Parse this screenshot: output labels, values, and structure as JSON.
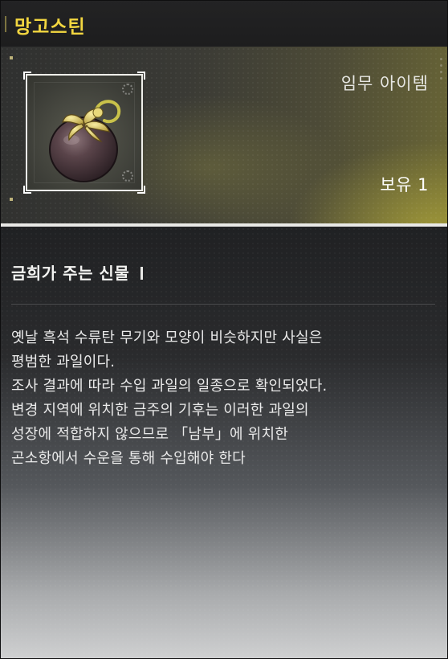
{
  "item": {
    "name": "망고스틴",
    "type": "임무 아이템",
    "owned": "보유 1",
    "icon": "mangosteen-icon"
  },
  "description": {
    "title": "금희가 주는 신물",
    "lines": [
      "옛날 흑석 수류탄 무기와 모양이 비슷하지만 사실은",
      "평범한 과일이다.",
      "조사 결과에 따라 수입 과일의 일종으로 확인되었다.",
      "변경 지역에 위치한 금주의 기후는 이러한 과일의",
      "성장에 적합하지 않으므로 「남부」에 위치한",
      "곤소항에서 수운을 통해 수입해야 한다"
    ]
  },
  "colors": {
    "title_accent": "#f2d640",
    "panel_highlight": "#c8be3c"
  }
}
